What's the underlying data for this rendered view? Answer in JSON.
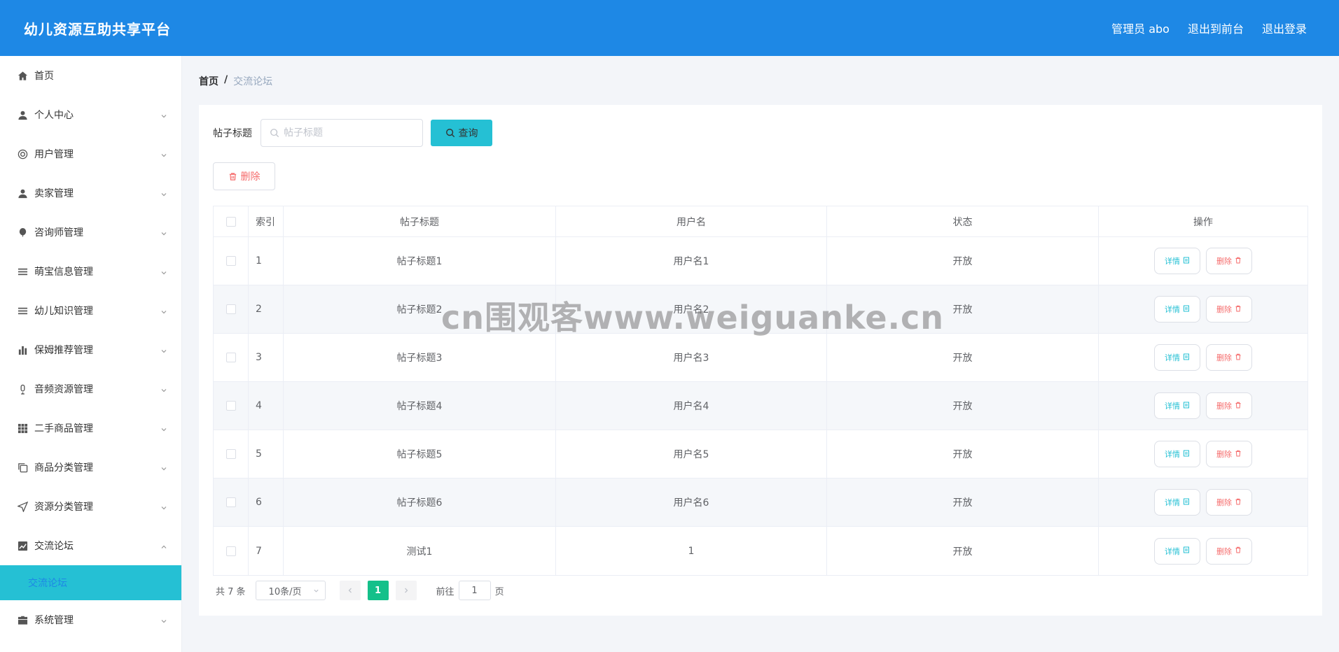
{
  "header": {
    "brand": "幼儿资源互助共享平台",
    "user_label": "管理员 abo",
    "to_front_label": "退出到前台",
    "logout_label": "退出登录"
  },
  "sidebar": {
    "items": [
      {
        "label": "首页",
        "icon": "home-icon",
        "has_arrow": false
      },
      {
        "label": "个人中心",
        "icon": "user-icon",
        "has_arrow": true
      },
      {
        "label": "用户管理",
        "icon": "lifebuoy-icon",
        "has_arrow": true
      },
      {
        "label": "卖家管理",
        "icon": "user-icon",
        "has_arrow": true
      },
      {
        "label": "咨询师管理",
        "icon": "balloon-icon",
        "has_arrow": true
      },
      {
        "label": "萌宝信息管理",
        "icon": "list-icon",
        "has_arrow": true
      },
      {
        "label": "幼儿知识管理",
        "icon": "list-icon",
        "has_arrow": true
      },
      {
        "label": "保姆推荐管理",
        "icon": "bar-chart-icon",
        "has_arrow": true
      },
      {
        "label": "音频资源管理",
        "icon": "microphone-icon",
        "has_arrow": true
      },
      {
        "label": "二手商品管理",
        "icon": "grid-icon",
        "has_arrow": true
      },
      {
        "label": "商品分类管理",
        "icon": "copy-icon",
        "has_arrow": true
      },
      {
        "label": "资源分类管理",
        "icon": "send-icon",
        "has_arrow": true
      },
      {
        "label": "交流论坛",
        "icon": "chart-icon",
        "has_arrow": true,
        "expanded": true
      },
      {
        "label": "系统管理",
        "icon": "briefcase-icon",
        "has_arrow": true
      }
    ],
    "active_submenu": "交流论坛"
  },
  "breadcrumb": {
    "home": "首页",
    "separator": "/",
    "current": "交流论坛"
  },
  "search": {
    "label": "帖子标题",
    "placeholder": "帖子标题",
    "value": "",
    "button_label": "查询"
  },
  "toolbar": {
    "delete_label": "删除"
  },
  "table": {
    "columns": [
      "索引",
      "帖子标题",
      "用户名",
      "状态",
      "操作"
    ],
    "rows": [
      {
        "index": "1",
        "title": "帖子标题1",
        "username": "用户名1",
        "status": "开放"
      },
      {
        "index": "2",
        "title": "帖子标题2",
        "username": "用户名2",
        "status": "开放"
      },
      {
        "index": "3",
        "title": "帖子标题3",
        "username": "用户名3",
        "status": "开放"
      },
      {
        "index": "4",
        "title": "帖子标题4",
        "username": "用户名4",
        "status": "开放"
      },
      {
        "index": "5",
        "title": "帖子标题5",
        "username": "用户名5",
        "status": "开放"
      },
      {
        "index": "6",
        "title": "帖子标题6",
        "username": "用户名6",
        "status": "开放"
      },
      {
        "index": "7",
        "title": "测试1",
        "username": "1",
        "status": "开放"
      }
    ],
    "detail_label": "详情",
    "remove_label": "删除"
  },
  "pagination": {
    "total": "共 7 条",
    "page_size": "10条/页",
    "current_page": "1",
    "goto_label": "前往",
    "goto_value": "1",
    "page_unit": "页"
  },
  "watermark": "cn围观客www.weiguanke.cn",
  "colors": {
    "header_bg": "#1e88e5",
    "accent": "#25c0d4",
    "page_active": "#14c08a",
    "danger": "#f56c6c"
  }
}
